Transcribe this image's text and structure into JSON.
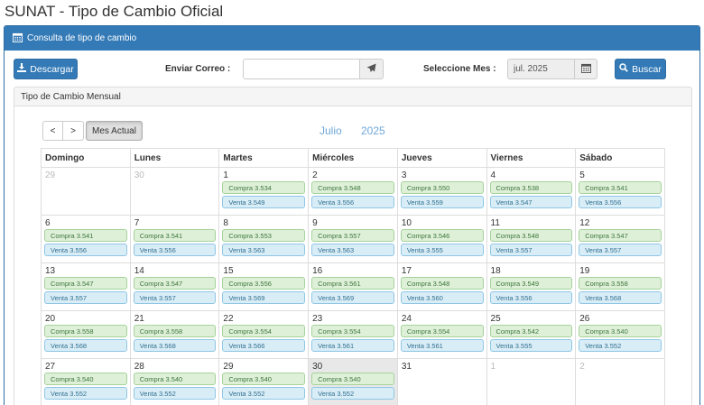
{
  "page": {
    "title": "SUNAT - Tipo de Cambio Oficial"
  },
  "panel": {
    "heading": "Consulta de tipo de cambio",
    "heading_icon": "calendar-icon"
  },
  "toolbar": {
    "download_label": "Descargar",
    "email_label": "Enviar Correo :",
    "email_value": "",
    "month_label": "Seleccione Mes :",
    "month_value": "jul. 2025",
    "search_label": "Buscar"
  },
  "calendar": {
    "heading": "Tipo de Cambio Mensual",
    "prev": "<",
    "next": ">",
    "today": "Mes Actual",
    "month": "Julio",
    "year": "2025",
    "weekdays": [
      "Domingo",
      "Lunes",
      "Martes",
      "Miércoles",
      "Jueves",
      "Viernes",
      "Sábado"
    ],
    "days": [
      {
        "day": "29",
        "other": true
      },
      {
        "day": "30",
        "other": true
      },
      {
        "day": "1",
        "compra": "Compra 3.534",
        "venta": "Venta 3.549"
      },
      {
        "day": "2",
        "compra": "Compra 3.548",
        "venta": "Venta 3.556"
      },
      {
        "day": "3",
        "compra": "Compra 3.550",
        "venta": "Venta 3.559"
      },
      {
        "day": "4",
        "compra": "Compra 3.538",
        "venta": "Venta 3.547"
      },
      {
        "day": "5",
        "compra": "Compra 3.541",
        "venta": "Venta 3.556"
      },
      {
        "day": "6",
        "compra": "Compra 3.541",
        "venta": "Venta 3.556"
      },
      {
        "day": "7",
        "compra": "Compra 3.541",
        "venta": "Venta 3.556"
      },
      {
        "day": "8",
        "compra": "Compra 3.553",
        "venta": "Venta 3.563"
      },
      {
        "day": "9",
        "compra": "Compra 3.557",
        "venta": "Venta 3.563"
      },
      {
        "day": "10",
        "compra": "Compra 3.546",
        "venta": "Venta 3.555"
      },
      {
        "day": "11",
        "compra": "Compra 3.548",
        "venta": "Venta 3.557"
      },
      {
        "day": "12",
        "compra": "Compra 3.547",
        "venta": "Venta 3.557"
      },
      {
        "day": "13",
        "compra": "Compra 3.547",
        "venta": "Venta 3.557"
      },
      {
        "day": "14",
        "compra": "Compra 3.547",
        "venta": "Venta 3.557"
      },
      {
        "day": "15",
        "compra": "Compra 3.556",
        "venta": "Venta 3.569"
      },
      {
        "day": "16",
        "compra": "Compra 3.561",
        "venta": "Venta 3.569"
      },
      {
        "day": "17",
        "compra": "Compra 3.548",
        "venta": "Venta 3.560"
      },
      {
        "day": "18",
        "compra": "Compra 3.549",
        "venta": "Venta 3.556"
      },
      {
        "day": "19",
        "compra": "Compra 3.558",
        "venta": "Venta 3.568"
      },
      {
        "day": "20",
        "compra": "Compra 3.558",
        "venta": "Venta 3.568"
      },
      {
        "day": "21",
        "compra": "Compra 3.558",
        "venta": "Venta 3.568"
      },
      {
        "day": "22",
        "compra": "Compra 3.554",
        "venta": "Venta 3.566"
      },
      {
        "day": "23",
        "compra": "Compra 3.554",
        "venta": "Venta 3.561"
      },
      {
        "day": "24",
        "compra": "Compra 3.554",
        "venta": "Venta 3.561"
      },
      {
        "day": "25",
        "compra": "Compra 3.542",
        "venta": "Venta 3.555"
      },
      {
        "day": "26",
        "compra": "Compra 3.540",
        "venta": "Venta 3.552"
      },
      {
        "day": "27",
        "compra": "Compra 3.540",
        "venta": "Venta 3.552"
      },
      {
        "day": "28",
        "compra": "Compra 3.540",
        "venta": "Venta 3.552"
      },
      {
        "day": "29",
        "compra": "Compra 3.540",
        "venta": "Venta 3.552"
      },
      {
        "day": "30",
        "compra": "Compra 3.540",
        "venta": "Venta 3.552",
        "today": true
      },
      {
        "day": "31"
      },
      {
        "day": "1",
        "other": true
      },
      {
        "day": "2",
        "other": true
      }
    ]
  }
}
